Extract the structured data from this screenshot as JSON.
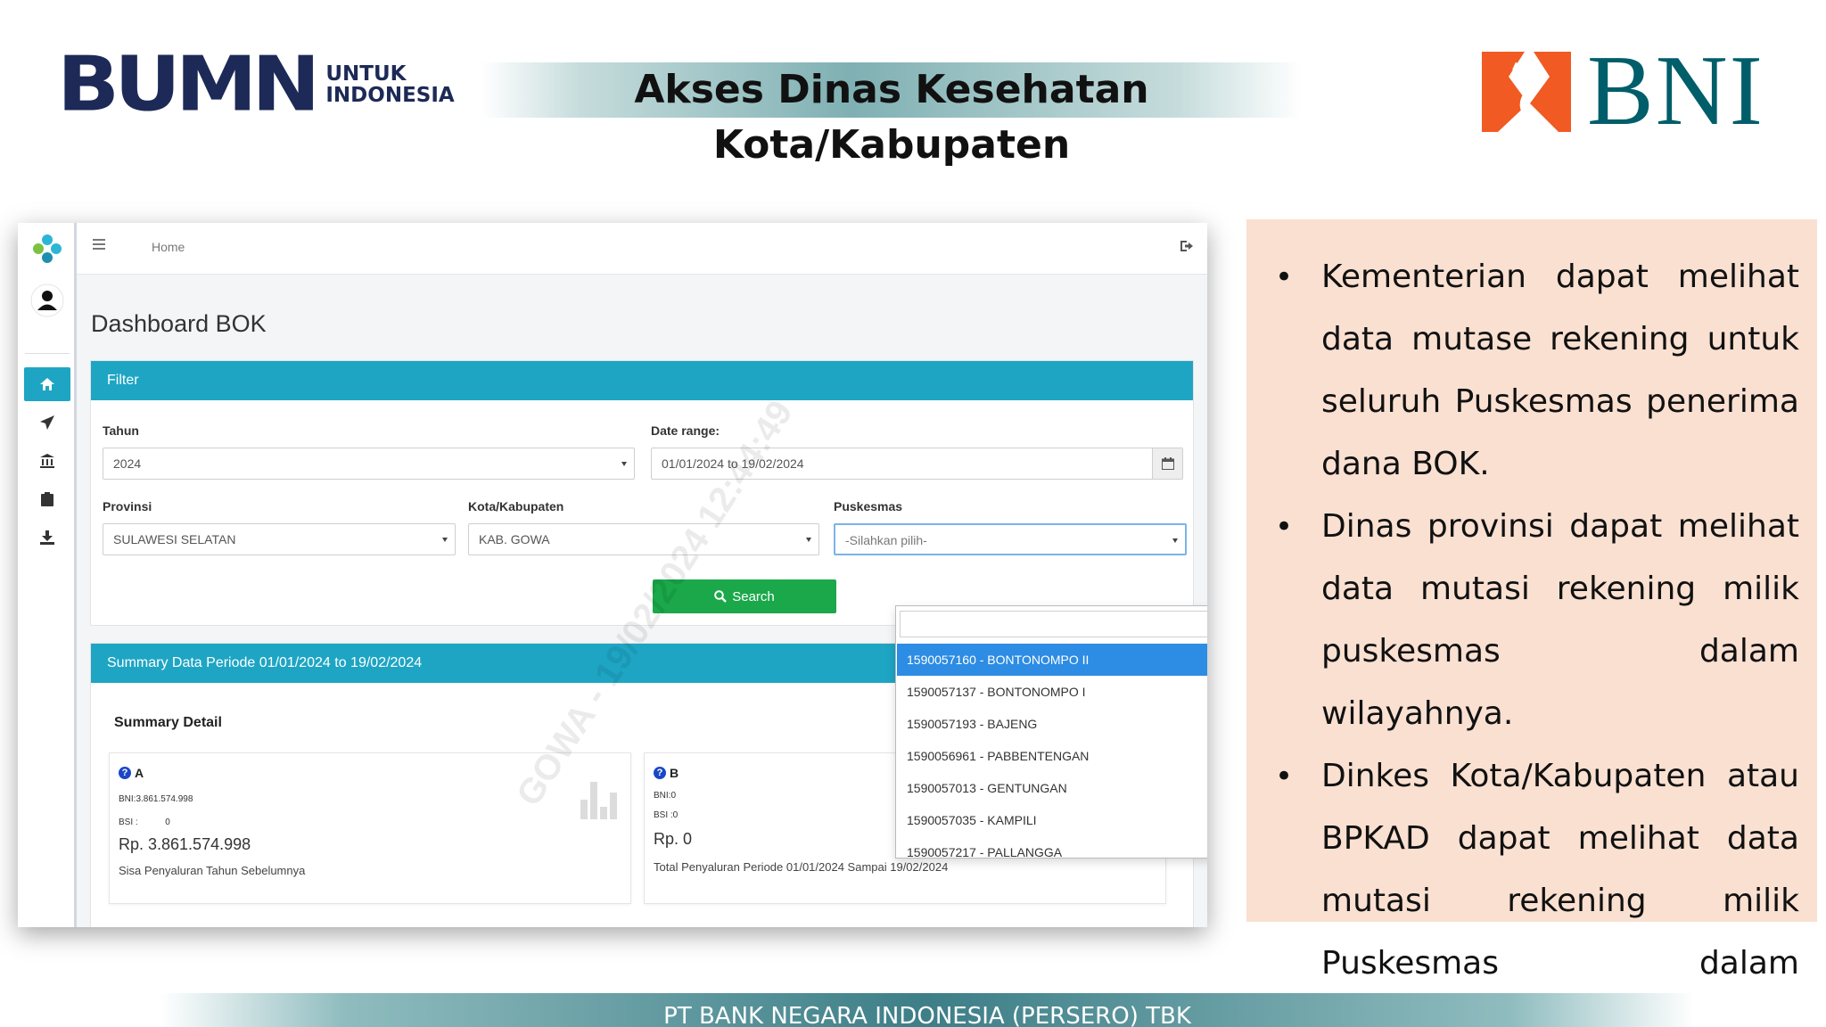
{
  "header": {
    "bumn_logo_main": "BUMN",
    "bumn_logo_sub_1": "UNTUK",
    "bumn_logo_sub_2": "INDONESIA",
    "title": "Akses Dinas Kesehatan Kota/Kabupaten",
    "bni_logo_text": "BNI"
  },
  "app": {
    "breadcrumb": "Home",
    "page_title": "Dashboard BOK",
    "sidebar_icons": [
      "home-icon",
      "send-icon",
      "bank-icon",
      "clipboard-icon",
      "download-icon"
    ],
    "accent_color": "#1ea5c4",
    "filter": {
      "heading": "Filter",
      "tahun_label": "Tahun",
      "tahun_value": "2024",
      "date_range_label": "Date range:",
      "date_range_value": "01/01/2024 to 19/02/2024",
      "provinsi_label": "Provinsi",
      "provinsi_value": "SULAWESI SELATAN",
      "kota_label": "Kota/Kabupaten",
      "kota_value": "KAB. GOWA",
      "puskesmas_label": "Puskesmas",
      "puskesmas_placeholder": "-Silahkan pilih-",
      "search_button": "Search"
    },
    "puskesmas_options": [
      "1590057160 - BONTONOMPO II",
      "1590057137 - BONTONOMPO I",
      "1590057193 - BAJENG",
      "1590056961 - PABBENTENGAN",
      "1590057013 - GENTUNGAN",
      "1590057035 - KAMPILI",
      "1590057217 - PALLANGGA"
    ],
    "summary": {
      "heading": "Summary Data Periode 01/01/2024 to 19/02/2024",
      "detail_label": "Summary Detail",
      "box_a": {
        "title": "A",
        "bni": "BNI:3.861.574.998",
        "bsi": "BSI :           0",
        "amount": "Rp. 3.861.574.998",
        "desc": "Sisa Penyaluran Tahun Sebelumnya"
      },
      "box_b": {
        "title": "B",
        "bni": "BNI:0",
        "bsi": "BSI :0",
        "amount": "Rp. 0",
        "desc": "Total Penyaluran Periode 01/01/2024 Sampai 19/02/2024"
      }
    },
    "watermark": "GOWA - 19/02/2024 12:44:49"
  },
  "bullets": [
    "Kementerian dapat melihat data mutase rekening untuk seluruh Puskesmas penerima dana BOK.",
    "Dinas provinsi dapat melihat data mutasi rekening milik puskesmas dalam wilayahnya.",
    "Dinkes Kota/Kabupaten atau BPKAD dapat melihat data mutasi rekening milik Puskesmas dalam wilayahnya."
  ],
  "footer": {
    "text": "PT BANK NEGARA INDONESIA (PERSERO) TBK"
  },
  "colors": {
    "bumn_navy": "#1d2a57",
    "bni_teal": "#005e6a",
    "bni_orange": "#f15a22",
    "panel_peach": "#f9e0d1",
    "search_green": "#1aa84a",
    "selected_blue": "#2d8ce3"
  }
}
